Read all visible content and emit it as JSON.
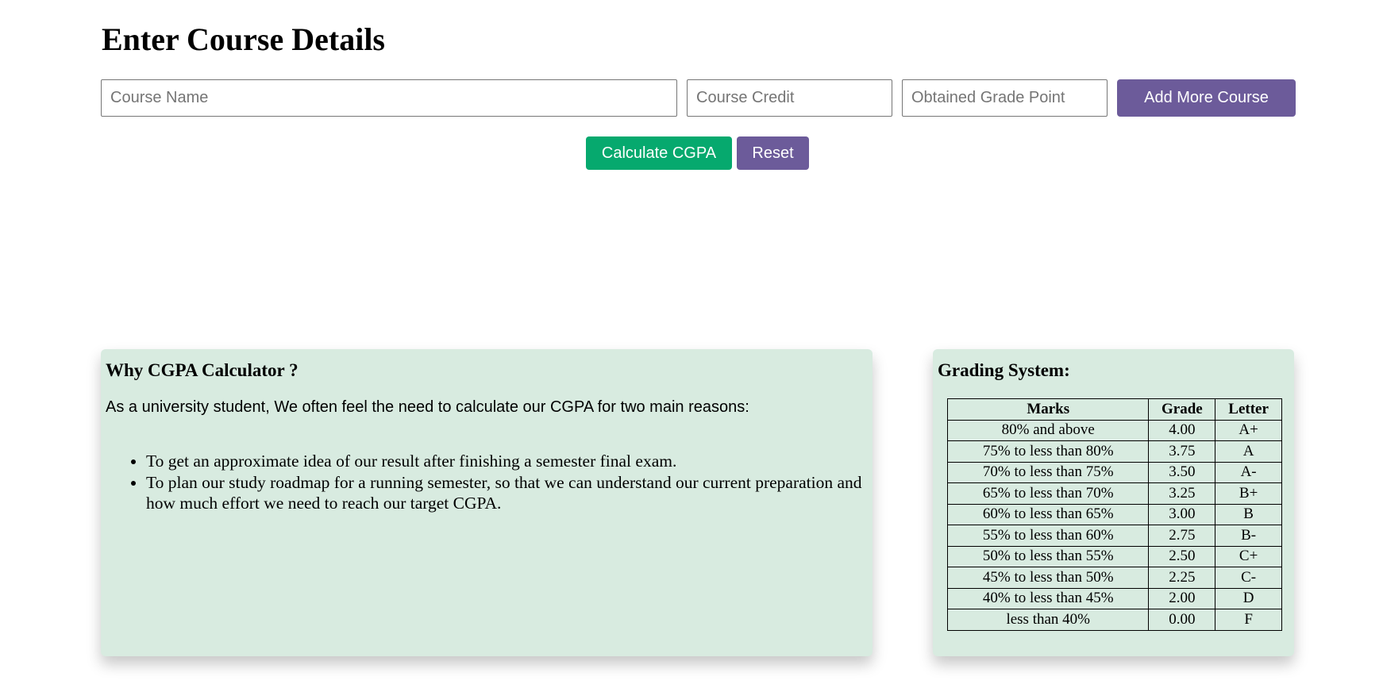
{
  "page_title": "Enter Course Details",
  "form": {
    "course_name_placeholder": "Course Name",
    "course_credit_placeholder": "Course Credit",
    "grade_point_placeholder": "Obtained Grade Point",
    "add_course_label": "Add More Course",
    "calculate_label": "Calculate CGPA",
    "reset_label": "Reset"
  },
  "why": {
    "heading": "Why CGPA Calculator ?",
    "intro": "As a university student, We often feel the need to calculate our CGPA for two main reasons:",
    "reasons": [
      "To get an approximate idea of our result after finishing a semester final exam.",
      "To plan our study roadmap for a running semester, so that we can understand our current preparation and how much effort we need to reach our target CGPA."
    ]
  },
  "grading": {
    "heading": "Grading System:",
    "headers": [
      "Marks",
      "Grade",
      "Letter"
    ],
    "rows": [
      [
        "80% and above",
        "4.00",
        "A+"
      ],
      [
        "75% to less than 80%",
        "3.75",
        "A"
      ],
      [
        "70% to less than 75%",
        "3.50",
        "A-"
      ],
      [
        "65% to less than 70%",
        "3.25",
        "B+"
      ],
      [
        "60% to less than 65%",
        "3.00",
        "B"
      ],
      [
        "55% to less than 60%",
        "2.75",
        "B-"
      ],
      [
        "50% to less than 55%",
        "2.50",
        "C+"
      ],
      [
        "45% to less than 50%",
        "2.25",
        "C-"
      ],
      [
        "40% to less than 45%",
        "2.00",
        "D"
      ],
      [
        "less than 40%",
        "0.00",
        "F"
      ]
    ]
  },
  "colors": {
    "primary_purple": "#6c5b9a",
    "calculate_green": "#06a96e",
    "card_background": "#d8ebe0"
  }
}
